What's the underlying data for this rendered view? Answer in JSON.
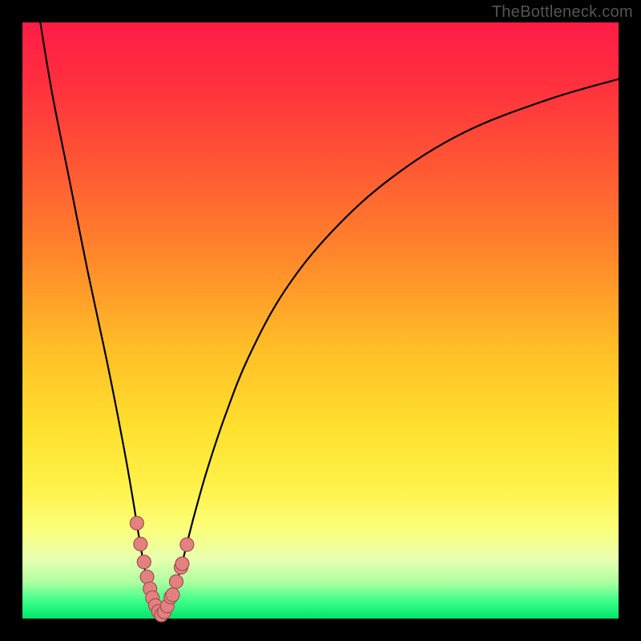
{
  "watermark": "TheBottleneck.com",
  "colors": {
    "frame_bg": "#000000",
    "curve_stroke": "#000000",
    "marker_fill": "#e38080",
    "marker_stroke": "#a05050",
    "gradient_stops": [
      "#ff1c47",
      "#ff2f3e",
      "#ff5a33",
      "#ff8a2a",
      "#ffbf27",
      "#ffe02e",
      "#fff24a",
      "#fbff7a",
      "#e8ffb0",
      "#abffa0",
      "#3fff8a",
      "#00e56a"
    ]
  },
  "chart_data": {
    "type": "line",
    "title": "",
    "xlabel": "",
    "ylabel": "",
    "xlim": [
      0,
      100
    ],
    "ylim": [
      0,
      100
    ],
    "series": [
      {
        "name": "left-branch",
        "x": [
          3,
          5,
          8,
          11,
          14,
          16,
          17.5,
          18.7,
          19.5,
          20.2,
          20.8,
          21.3,
          21.8,
          22.4,
          23.3
        ],
        "values": [
          100,
          88,
          73,
          58,
          44,
          34,
          26,
          19,
          14,
          10,
          7,
          5,
          3.5,
          2,
          0.4
        ]
      },
      {
        "name": "right-branch",
        "x": [
          23.3,
          24.2,
          25,
          25.8,
          26.7,
          27.7,
          29,
          31,
          34,
          38,
          44,
          52,
          62,
          74,
          88,
          100
        ],
        "values": [
          0.4,
          2,
          3.8,
          6,
          9,
          13,
          18,
          25,
          34,
          44,
          55,
          65,
          74,
          81.5,
          87,
          90.5
        ]
      }
    ],
    "markers": {
      "name": "highlighted-points",
      "x": [
        19.2,
        19.8,
        20.4,
        20.9,
        21.4,
        21.8,
        22.3,
        22.8,
        23.3,
        23.8,
        24.3,
        24.9,
        25.2,
        25.8,
        26.6,
        26.8,
        27.6
      ],
      "values": [
        16,
        12.5,
        9.5,
        7,
        5,
        3.5,
        2.2,
        1.2,
        0.6,
        1.1,
        2.1,
        3.6,
        4,
        6.2,
        8.6,
        9.2,
        12.4
      ]
    },
    "annotations": []
  }
}
